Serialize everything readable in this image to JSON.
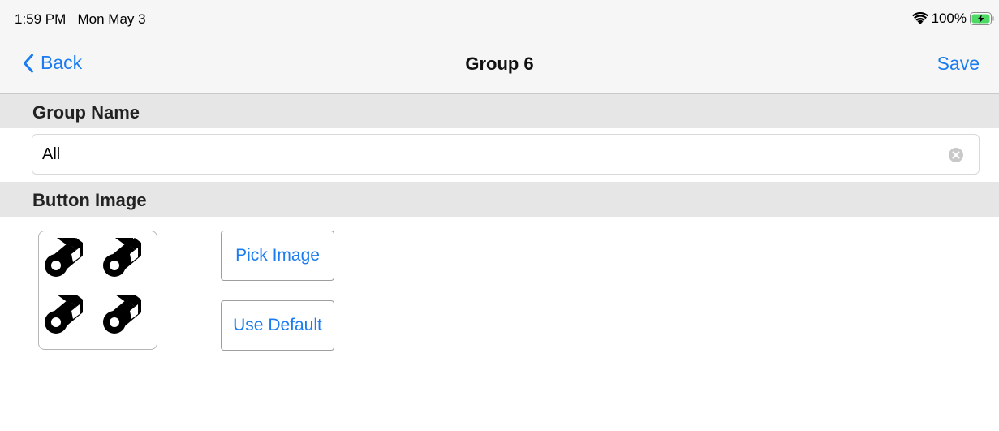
{
  "status_bar": {
    "time": "1:59 PM",
    "date": "Mon May 3",
    "battery": "100%"
  },
  "nav": {
    "back_label": "Back",
    "title": "Group 6",
    "save_label": "Save",
    "accent_color": "#1a7cf0"
  },
  "sections": {
    "group_name": {
      "header": "Group Name",
      "value": "All"
    },
    "button_image": {
      "header": "Button Image",
      "pick_label": "Pick Image",
      "default_label": "Use Default"
    }
  },
  "icons": {
    "wifi": "wifi-icon",
    "battery": "battery-charging-icon",
    "back": "chevron-left-icon",
    "clear": "clear-icon",
    "preview": "film-rolls-icon"
  }
}
